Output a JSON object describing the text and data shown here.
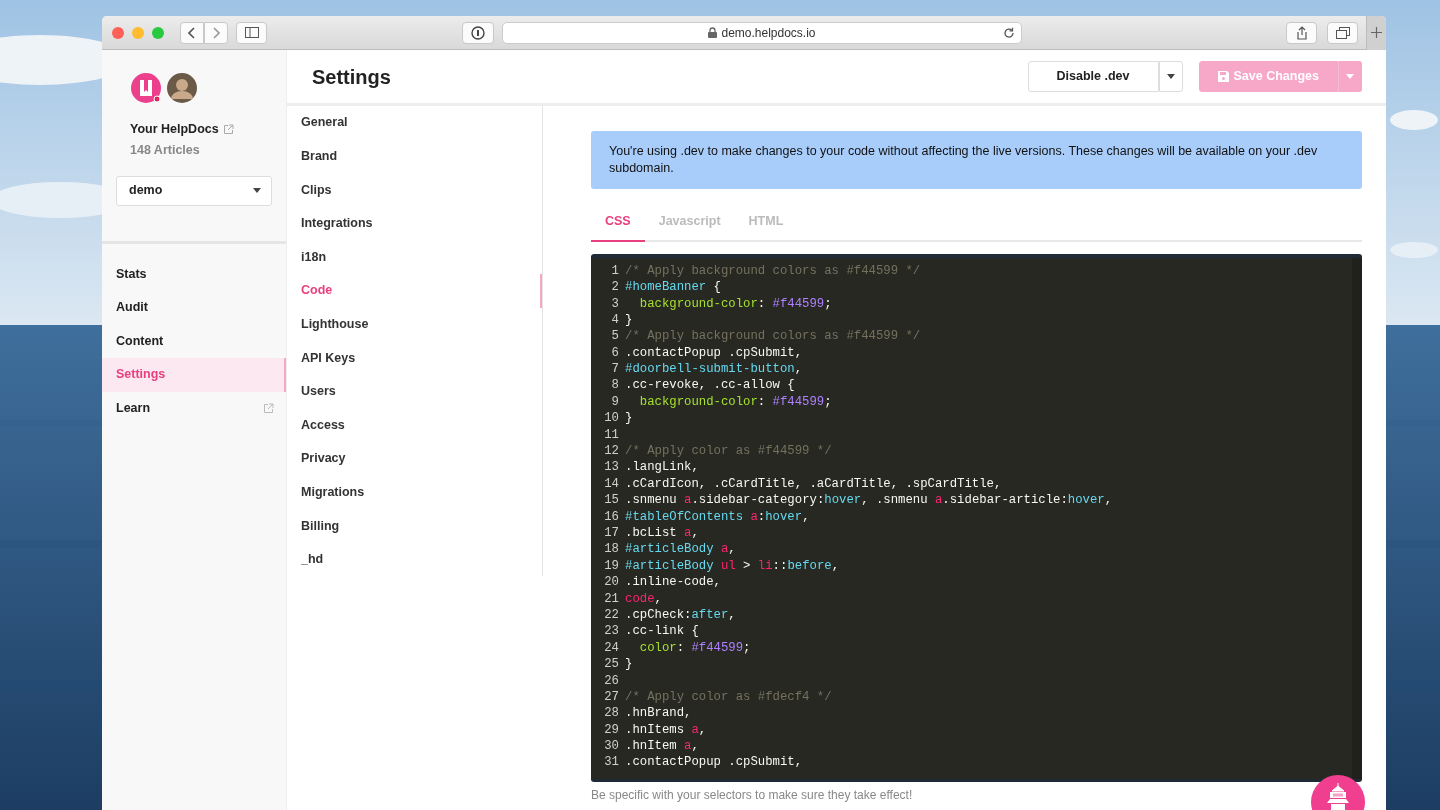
{
  "browser": {
    "url": "demo.helpdocs.io"
  },
  "sidebar": {
    "site_name": "Your HelpDocs",
    "article_count": "148 Articles",
    "site_select": {
      "value": "demo"
    },
    "items": [
      {
        "label": "Stats",
        "selected": false,
        "external": false
      },
      {
        "label": "Audit",
        "selected": false,
        "external": false
      },
      {
        "label": "Content",
        "selected": false,
        "external": false
      },
      {
        "label": "Settings",
        "selected": true,
        "external": false
      },
      {
        "label": "Learn",
        "selected": false,
        "external": true
      }
    ]
  },
  "header": {
    "title": "Settings",
    "buttons": [
      {
        "label": "Disable .dev",
        "kind": "secondary",
        "disabled": false
      },
      {
        "label": "Save Changes",
        "kind": "primary",
        "disabled": true
      }
    ]
  },
  "settings_menu": {
    "items": [
      {
        "label": "General",
        "selected": false
      },
      {
        "label": "Brand",
        "selected": false
      },
      {
        "label": "Clips",
        "selected": false
      },
      {
        "label": "Integrations",
        "selected": false
      },
      {
        "label": "i18n",
        "selected": false
      },
      {
        "label": "Code",
        "selected": true
      },
      {
        "label": "Lighthouse",
        "selected": false
      },
      {
        "label": "API Keys",
        "selected": false
      },
      {
        "label": "Users",
        "selected": false
      },
      {
        "label": "Access",
        "selected": false
      },
      {
        "label": "Privacy",
        "selected": false
      },
      {
        "label": "Migrations",
        "selected": false
      },
      {
        "label": "Billing",
        "selected": false
      },
      {
        "label": "_hd",
        "selected": false
      }
    ]
  },
  "alert": {
    "text": "You're using .dev to make changes to your code without affecting the live versions. These changes will be available on your .dev subdomain."
  },
  "tabs": [
    {
      "label": "CSS",
      "selected": true
    },
    {
      "label": "Javascript",
      "selected": false
    },
    {
      "label": "HTML",
      "selected": false
    }
  ],
  "code": {
    "lines": [
      {
        "number": "1",
        "tokens": [
          {
            "kind": "comment",
            "text": "/* Apply background colors as #f44599 */"
          }
        ]
      },
      {
        "number": "2",
        "tokens": [
          {
            "kind": "id",
            "text": "#homeBanner"
          },
          {
            "kind": "plain",
            "text": " {"
          }
        ]
      },
      {
        "number": "3",
        "indent": true,
        "tokens": [
          {
            "kind": "property",
            "text": "background-color"
          },
          {
            "kind": "plain",
            "text": ": "
          },
          {
            "kind": "value",
            "text": "#f44599"
          },
          {
            "kind": "plain",
            "text": ";"
          }
        ]
      },
      {
        "number": "4",
        "tokens": [
          {
            "kind": "plain",
            "text": "}"
          }
        ]
      },
      {
        "number": "5",
        "tokens": [
          {
            "kind": "comment",
            "text": "/* Apply background colors as #f44599 */"
          }
        ]
      },
      {
        "number": "6",
        "tokens": [
          {
            "kind": "plain",
            "text": ".contactPopup .cpSubmit,"
          }
        ]
      },
      {
        "number": "7",
        "tokens": [
          {
            "kind": "id",
            "text": "#doorbell-submit-button"
          },
          {
            "kind": "plain",
            "text": ","
          }
        ]
      },
      {
        "number": "8",
        "tokens": [
          {
            "kind": "plain",
            "text": ".cc-revoke, .cc-allow {"
          }
        ]
      },
      {
        "number": "9",
        "indent": true,
        "tokens": [
          {
            "kind": "property",
            "text": "background-color"
          },
          {
            "kind": "plain",
            "text": ": "
          },
          {
            "kind": "value",
            "text": "#f44599"
          },
          {
            "kind": "plain",
            "text": ";"
          }
        ]
      },
      {
        "number": "10",
        "tokens": [
          {
            "kind": "plain",
            "text": "}"
          }
        ]
      },
      {
        "number": "11"
      },
      {
        "number": "12",
        "tokens": [
          {
            "kind": "comment",
            "text": "/* Apply color as #f44599 */"
          }
        ]
      },
      {
        "number": "13",
        "tokens": [
          {
            "kind": "plain",
            "text": ".langLink,"
          }
        ]
      },
      {
        "number": "14",
        "tokens": [
          {
            "kind": "plain",
            "text": ".cCardIcon, .cCardTitle, .aCardTitle, .spCardTitle,"
          }
        ]
      },
      {
        "number": "15",
        "tokens": [
          {
            "kind": "plain",
            "text": ".snmenu "
          },
          {
            "kind": "tag",
            "text": "a"
          },
          {
            "kind": "plain",
            "text": ".sidebar-category:"
          },
          {
            "kind": "pseudo",
            "text": "hover"
          },
          {
            "kind": "plain",
            "text": ", .snmenu "
          },
          {
            "kind": "tag",
            "text": "a"
          },
          {
            "kind": "plain",
            "text": ".sidebar-article:"
          },
          {
            "kind": "pseudo",
            "text": "hover"
          },
          {
            "kind": "plain",
            "text": ","
          }
        ]
      },
      {
        "number": "16",
        "tokens": [
          {
            "kind": "id",
            "text": "#tableOfContents "
          },
          {
            "kind": "tag",
            "text": "a"
          },
          {
            "kind": "plain",
            "text": ":"
          },
          {
            "kind": "pseudo",
            "text": "hover"
          },
          {
            "kind": "plain",
            "text": ","
          }
        ]
      },
      {
        "number": "17",
        "tokens": [
          {
            "kind": "plain",
            "text": ".bcList "
          },
          {
            "kind": "tag",
            "text": "a"
          },
          {
            "kind": "plain",
            "text": ","
          }
        ]
      },
      {
        "number": "18",
        "tokens": [
          {
            "kind": "id",
            "text": "#articleBody "
          },
          {
            "kind": "tag",
            "text": "a"
          },
          {
            "kind": "plain",
            "text": ","
          }
        ]
      },
      {
        "number": "19",
        "tokens": [
          {
            "kind": "id",
            "text": "#articleBody "
          },
          {
            "kind": "tag",
            "text": "ul"
          },
          {
            "kind": "plain",
            "text": " > "
          },
          {
            "kind": "tag",
            "text": "li"
          },
          {
            "kind": "plain",
            "text": "::"
          },
          {
            "kind": "pseudo",
            "text": "before"
          },
          {
            "kind": "plain",
            "text": ","
          }
        ]
      },
      {
        "number": "20",
        "tokens": [
          {
            "kind": "plain",
            "text": ".inline-code,"
          }
        ]
      },
      {
        "number": "21",
        "tokens": [
          {
            "kind": "tag",
            "text": "code"
          },
          {
            "kind": "plain",
            "text": ","
          }
        ]
      },
      {
        "number": "22",
        "tokens": [
          {
            "kind": "plain",
            "text": ".cpCheck:"
          },
          {
            "kind": "pseudo",
            "text": "after"
          },
          {
            "kind": "plain",
            "text": ","
          }
        ]
      },
      {
        "number": "23",
        "tokens": [
          {
            "kind": "plain",
            "text": ".cc-link {"
          }
        ]
      },
      {
        "number": "24",
        "indent": true,
        "tokens": [
          {
            "kind": "property",
            "text": "color"
          },
          {
            "kind": "plain",
            "text": ": "
          },
          {
            "kind": "value",
            "text": "#f44599"
          },
          {
            "kind": "plain",
            "text": ";"
          }
        ]
      },
      {
        "number": "25",
        "tokens": [
          {
            "kind": "plain",
            "text": "}"
          }
        ]
      },
      {
        "number": "26"
      },
      {
        "number": "27",
        "tokens": [
          {
            "kind": "comment",
            "text": "/* Apply color as #fdecf4 */"
          }
        ]
      },
      {
        "number": "28",
        "tokens": [
          {
            "kind": "plain",
            "text": ".hnBrand,"
          }
        ]
      },
      {
        "number": "29",
        "tokens": [
          {
            "kind": "plain",
            "text": ".hnItems "
          },
          {
            "kind": "tag",
            "text": "a"
          },
          {
            "kind": "plain",
            "text": ","
          }
        ]
      },
      {
        "number": "30",
        "tokens": [
          {
            "kind": "plain",
            "text": ".hnItem "
          },
          {
            "kind": "tag",
            "text": "a"
          },
          {
            "kind": "plain",
            "text": ","
          }
        ]
      },
      {
        "number": "31",
        "tokens": [
          {
            "kind": "plain",
            "text": ".contactPopup .cpSubmit,"
          }
        ]
      }
    ]
  },
  "hint": "Be specific with your selectors to make sure they take effect!"
}
